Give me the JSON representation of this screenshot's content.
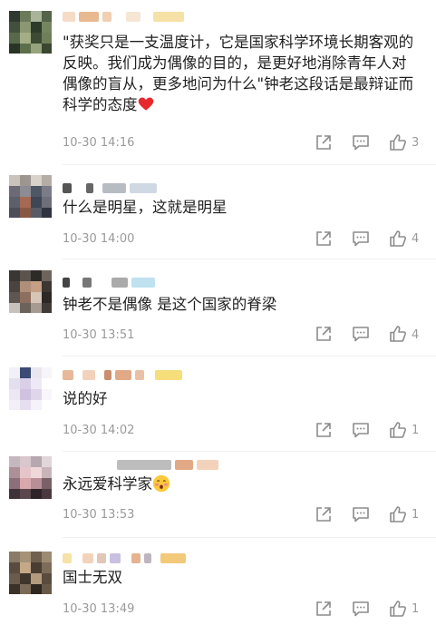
{
  "comments": [
    {
      "text": "\"获奖只是一支温度计，它是国家科学环境长期客观的反映。我们成为偶像的目的，是更好地消除青年人对偶像的盲从，更多地问为什么\"钟老这段话是最辩证而科学的态度",
      "time": "10-30 14:16",
      "likes": "3"
    },
    {
      "text": "什么是明星，这就是明星",
      "time": "10-30 14:00",
      "likes": "4"
    },
    {
      "text": "钟老不是偶像 是这个国家的脊梁",
      "time": "10-30 13:51",
      "likes": "4"
    },
    {
      "text": "说的好",
      "time": "10-30 14:02",
      "likes": "1"
    },
    {
      "text": "永远爱科学家",
      "time": "10-30 13:53",
      "likes": "1"
    },
    {
      "text": "国士无双",
      "time": "10-30 13:49",
      "likes": "1"
    }
  ],
  "icons": {
    "share": "share-icon",
    "reply": "reply-comment-icon",
    "like": "thumbs-up-icon",
    "heart": "red-heart-emoji",
    "face": "blushing-face-emoji"
  },
  "colors": {
    "text": "#1f1f1f",
    "meta": "#9a9a9a",
    "heart": "#e8282b"
  }
}
